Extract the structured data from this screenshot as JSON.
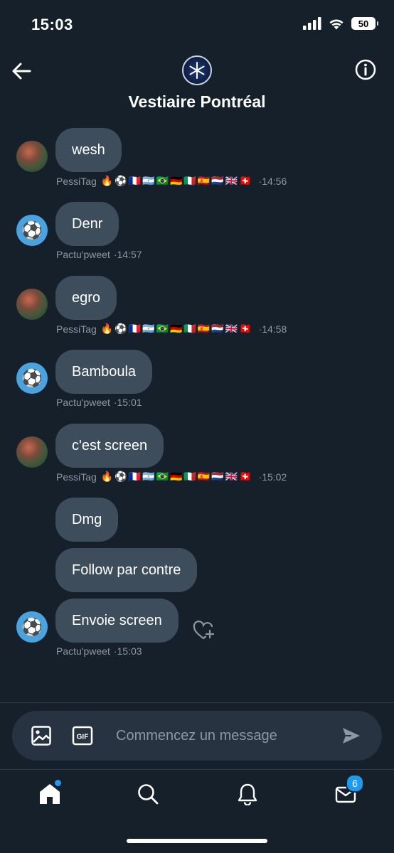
{
  "status_bar": {
    "time": "15:03",
    "battery": "50"
  },
  "header": {
    "title": "Vestiaire Pontréal"
  },
  "messages": [
    {
      "text": "wesh",
      "sender": "PessiTag",
      "emojis": "🔥⚽🇫🇷🇦🇷🇧🇷🇩🇪🇮🇹🇪🇸🇳🇱🇬🇧🇨🇭",
      "time": "·14:56"
    },
    {
      "text": "Denr",
      "sender": "Pactu'pweet",
      "time": "·14:57"
    },
    {
      "text": "egro",
      "sender": "PessiTag",
      "emojis": "🔥⚽🇫🇷🇦🇷🇧🇷🇩🇪🇮🇹🇪🇸🇳🇱🇬🇧🇨🇭",
      "time": "·14:58"
    },
    {
      "text": "Bamboula",
      "sender": "Pactu'pweet",
      "time": "·15:01"
    },
    {
      "text": "c'est screen",
      "sender": "PessiTag",
      "emojis": "🔥⚽🇫🇷🇦🇷🇧🇷🇩🇪🇮🇹🇪🇸🇳🇱🇬🇧🇨🇭",
      "time": "·15:02"
    },
    {
      "text": "Dmg"
    },
    {
      "text": "Follow par contre"
    },
    {
      "text": "Envoie screen",
      "sender": "Pactu'pweet",
      "time": "·15:03"
    }
  ],
  "composer": {
    "placeholder": "Commencez un message"
  },
  "nav": {
    "messages_badge": "6"
  },
  "colors": {
    "background": "#15202b",
    "bubble": "#3e4d5c",
    "accent": "#1d9bf0",
    "meta_text": "#8b98a5"
  },
  "icons": [
    "back-arrow-icon",
    "info-icon",
    "image-icon",
    "gif-icon",
    "send-icon",
    "home-icon",
    "search-icon",
    "bell-icon",
    "mail-icon",
    "heart-plus-icon",
    "soccer-ball-icon"
  ]
}
